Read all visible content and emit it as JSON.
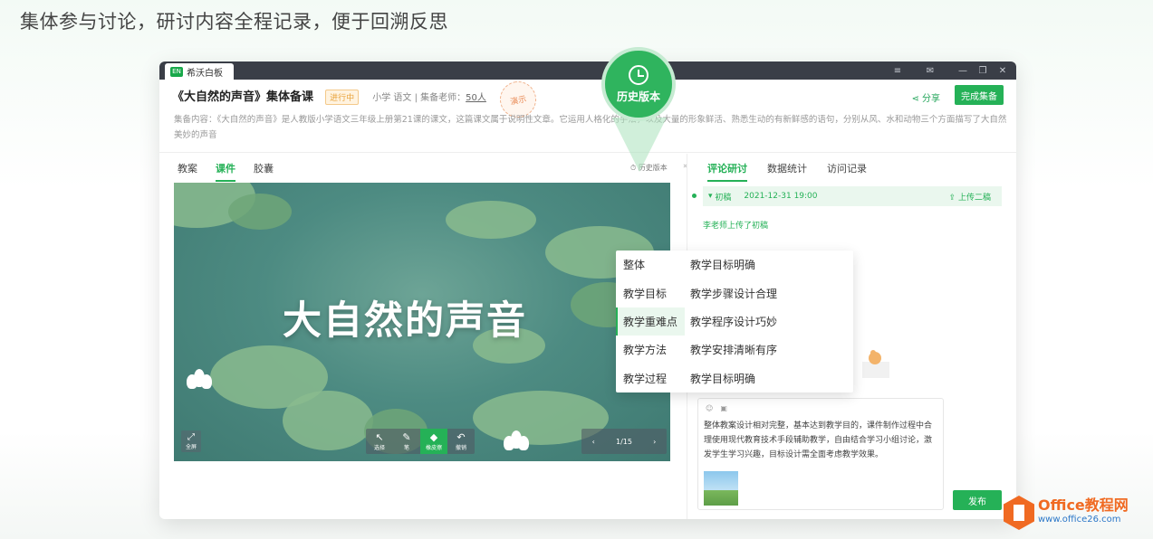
{
  "caption": "集体参与讨论，研讨内容全程记录，便于回溯反思",
  "app": {
    "tab_logo": "EN",
    "tab_title": "希沃白板",
    "controls": [
      "≡",
      "✉",
      "—",
      "❐",
      "✕"
    ]
  },
  "header": {
    "title": "《大自然的声音》集体备课",
    "status": "进行中",
    "meta": "小学  语文 | 集备老师：",
    "teacher_count": "50人",
    "stamp": "演示",
    "share_label": "分享",
    "done_label": "完成集备",
    "description": "集备内容：《大自然的声音》是人教版小学语文三年级上册第21课的课文，这篇课文属于说明性文章。它运用人格化的手法，以及大量的形象鲜活、熟悉生动的有新鲜感的语句，分别从风、水和动物三个方面描写了大自然美妙的声音"
  },
  "left_tabs": [
    "教案",
    "课件",
    "胶囊"
  ],
  "left_active_tab": "课件",
  "history_link": "历史版本",
  "slide": {
    "title": "大自然的声音",
    "full_label": "全屏",
    "tools": [
      {
        "icon": "↖",
        "label": "选择"
      },
      {
        "icon": "✎",
        "label": "笔"
      },
      {
        "icon": "◆",
        "label": "橡皮擦"
      },
      {
        "icon": "↶",
        "label": "撤销"
      }
    ],
    "page_indicator": "1/15",
    "prev_label": "上一页",
    "next_label": "下一页",
    "page_label": "页码"
  },
  "right_tabs": [
    "评论研讨",
    "数据统计",
    "访问记录"
  ],
  "right_active_tab": "评论研讨",
  "draft": {
    "name": "初稿",
    "time": "2021-12-31 19:00",
    "upload_label": "上传二稿",
    "uploaded_note": "李老师上传了初稿"
  },
  "popup": {
    "categories": [
      "整体",
      "教学目标",
      "教学重难点",
      "教学方法",
      "教学过程"
    ],
    "active": "教学重难点",
    "phrases": [
      "教学目标明确",
      "教学步骤设计合理",
      "教学程序设计巧妙",
      "教学安排清晰有序",
      "教学目标明确"
    ]
  },
  "comment": {
    "text": "整体教案设计相对完整，基本达到教学目的，课件制作过程中合理使用现代教育技术手段辅助教学，自由结合学习小组讨论，激发学生学习兴趣，目标设计需全面考虑教学效果。",
    "publish_label": "发布"
  },
  "history_badge": "历史版本",
  "watermark": {
    "line1": "Office教程网",
    "line2": "www.office26.com"
  },
  "colors": {
    "accent": "#25b157",
    "status": "#e8a23a",
    "brand_orange": "#f06a22"
  }
}
